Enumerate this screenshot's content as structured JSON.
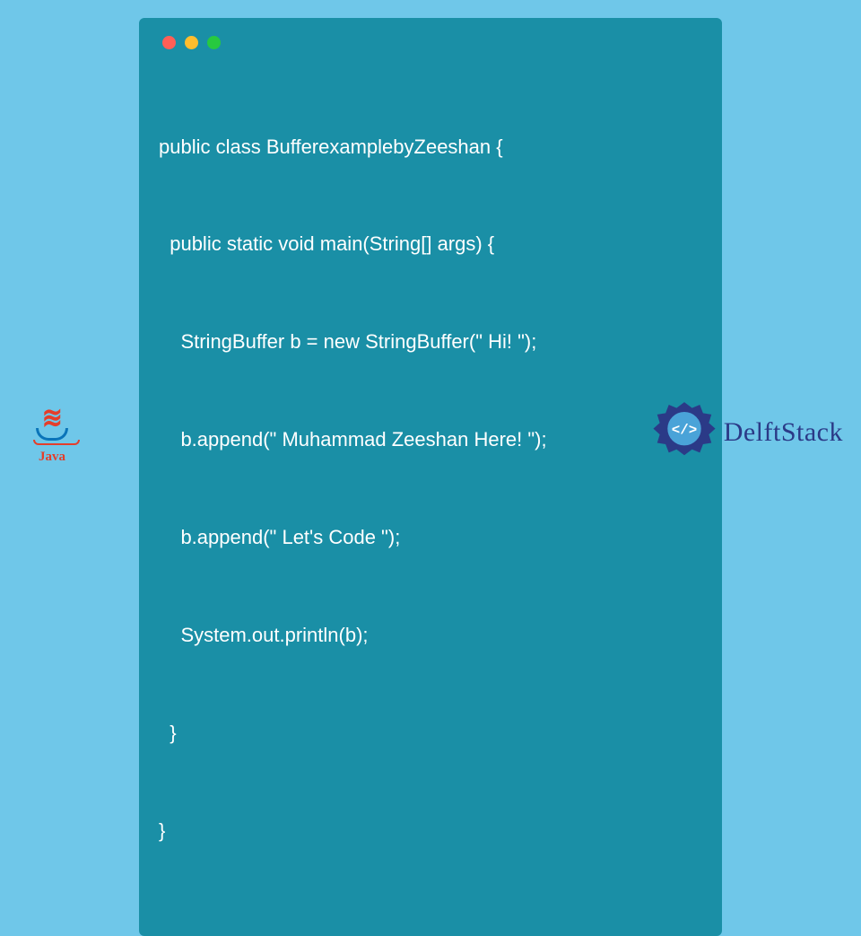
{
  "code": {
    "lines": [
      "public class BufferexamplebyZeeshan {",
      "  public static void main(String[] args) {",
      "    StringBuffer b = new StringBuffer(\" Hi! \");",
      "    b.append(\" Muhammad Zeeshan Here! \");",
      "    b.append(\" Let's Code \");",
      "    System.out.println(b);",
      "  }",
      "}"
    ]
  },
  "logos": {
    "java_label": "Java",
    "delft_label": "DelftStack",
    "delft_badge_text": "</>"
  },
  "window": {
    "dots": [
      "red",
      "yellow",
      "green"
    ]
  }
}
